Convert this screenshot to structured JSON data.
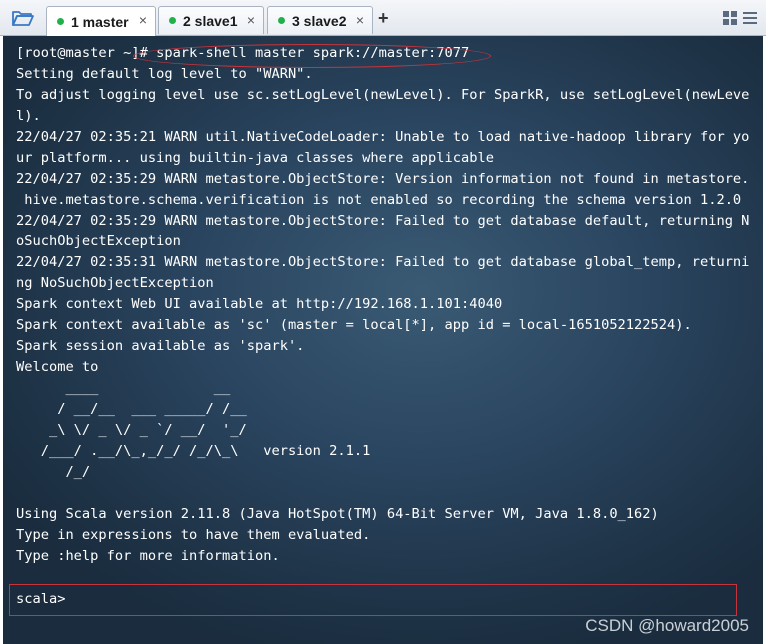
{
  "tabs": [
    {
      "label": "1 master",
      "status_color": "#21b14b",
      "active": true
    },
    {
      "label": "2 slave1",
      "status_color": "#21b14b",
      "active": false
    },
    {
      "label": "3 slave2",
      "status_color": "#21b14b",
      "active": false
    }
  ],
  "toolbar": {
    "folder_icon": "folder-open-icon",
    "add_tab_icon": "plus-icon",
    "close_glyph": "×",
    "add_glyph": "+"
  },
  "terminal": {
    "lines": [
      "[root@master ~]# spark-shell master spark://master:7077",
      "Setting default log level to \"WARN\".",
      "To adjust logging level use sc.setLogLevel(newLevel). For SparkR, use setLogLevel(newLeve",
      "l).",
      "22/04/27 02:35:21 WARN util.NativeCodeLoader: Unable to load native-hadoop library for yo",
      "ur platform... using builtin-java classes where applicable",
      "22/04/27 02:35:29 WARN metastore.ObjectStore: Version information not found in metastore.",
      " hive.metastore.schema.verification is not enabled so recording the schema version 1.2.0",
      "22/04/27 02:35:29 WARN metastore.ObjectStore: Failed to get database default, returning N",
      "oSuchObjectException",
      "22/04/27 02:35:31 WARN metastore.ObjectStore: Failed to get database global_temp, returni",
      "ng NoSuchObjectException",
      "Spark context Web UI available at http://192.168.1.101:4040",
      "Spark context available as 'sc' (master = local[*], app id = local-1651052122524).",
      "Spark session available as 'spark'.",
      "Welcome to",
      "      ____              __",
      "     / __/__  ___ _____/ /__",
      "    _\\ \\/ _ \\/ _ `/ __/  '_/",
      "   /___/ .__/\\_,_/_/ /_/\\_\\   version 2.1.1",
      "      /_/",
      "",
      "Using Scala version 2.11.8 (Java HotSpot(TM) 64-Bit Server VM, Java 1.8.0_162)",
      "Type in expressions to have them evaluated.",
      "Type :help for more information."
    ],
    "prompt": "scala>",
    "text_color": "#ffffff",
    "annotation_color": "#c8343c"
  },
  "watermark": "CSDN @howard2005"
}
